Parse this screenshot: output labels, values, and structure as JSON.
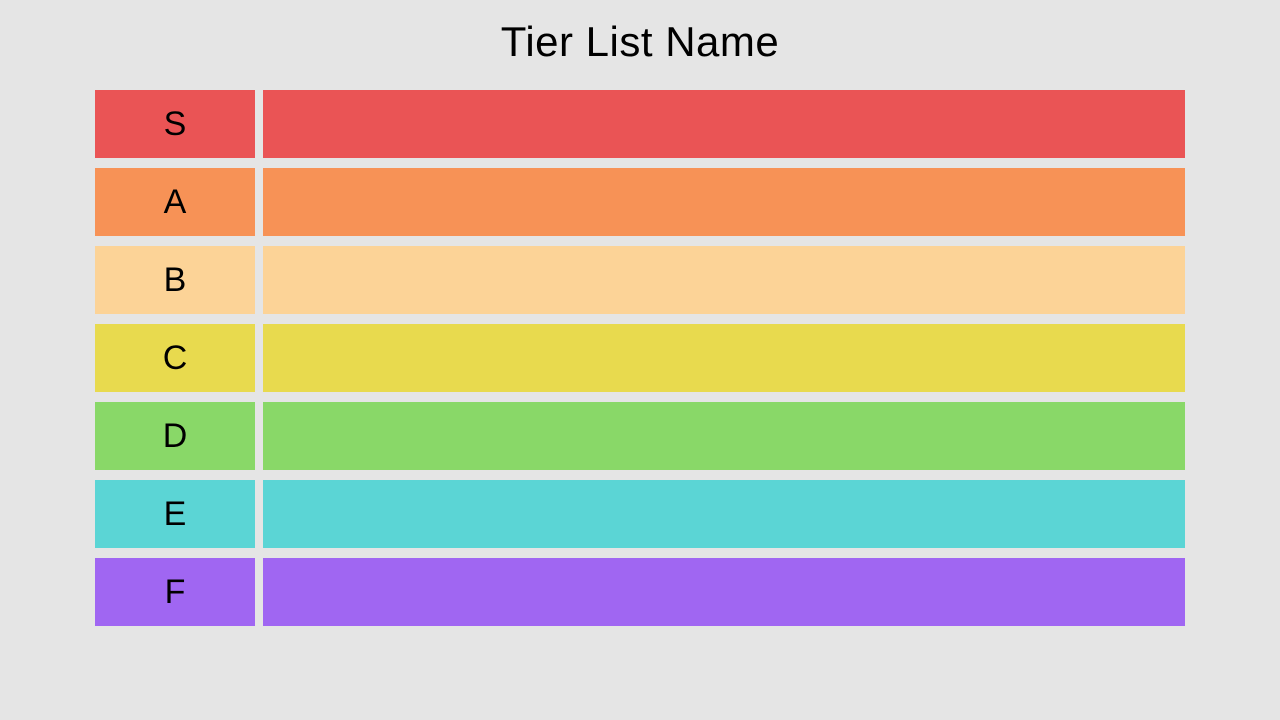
{
  "title": "Tier List Name",
  "tiers": [
    {
      "label": "S",
      "color": "#ea5455"
    },
    {
      "label": "A",
      "color": "#f79256"
    },
    {
      "label": "B",
      "color": "#fcd397"
    },
    {
      "label": "C",
      "color": "#e8da4e"
    },
    {
      "label": "D",
      "color": "#89d868"
    },
    {
      "label": "E",
      "color": "#5bd5d5"
    },
    {
      "label": "F",
      "color": "#a066f2"
    }
  ]
}
